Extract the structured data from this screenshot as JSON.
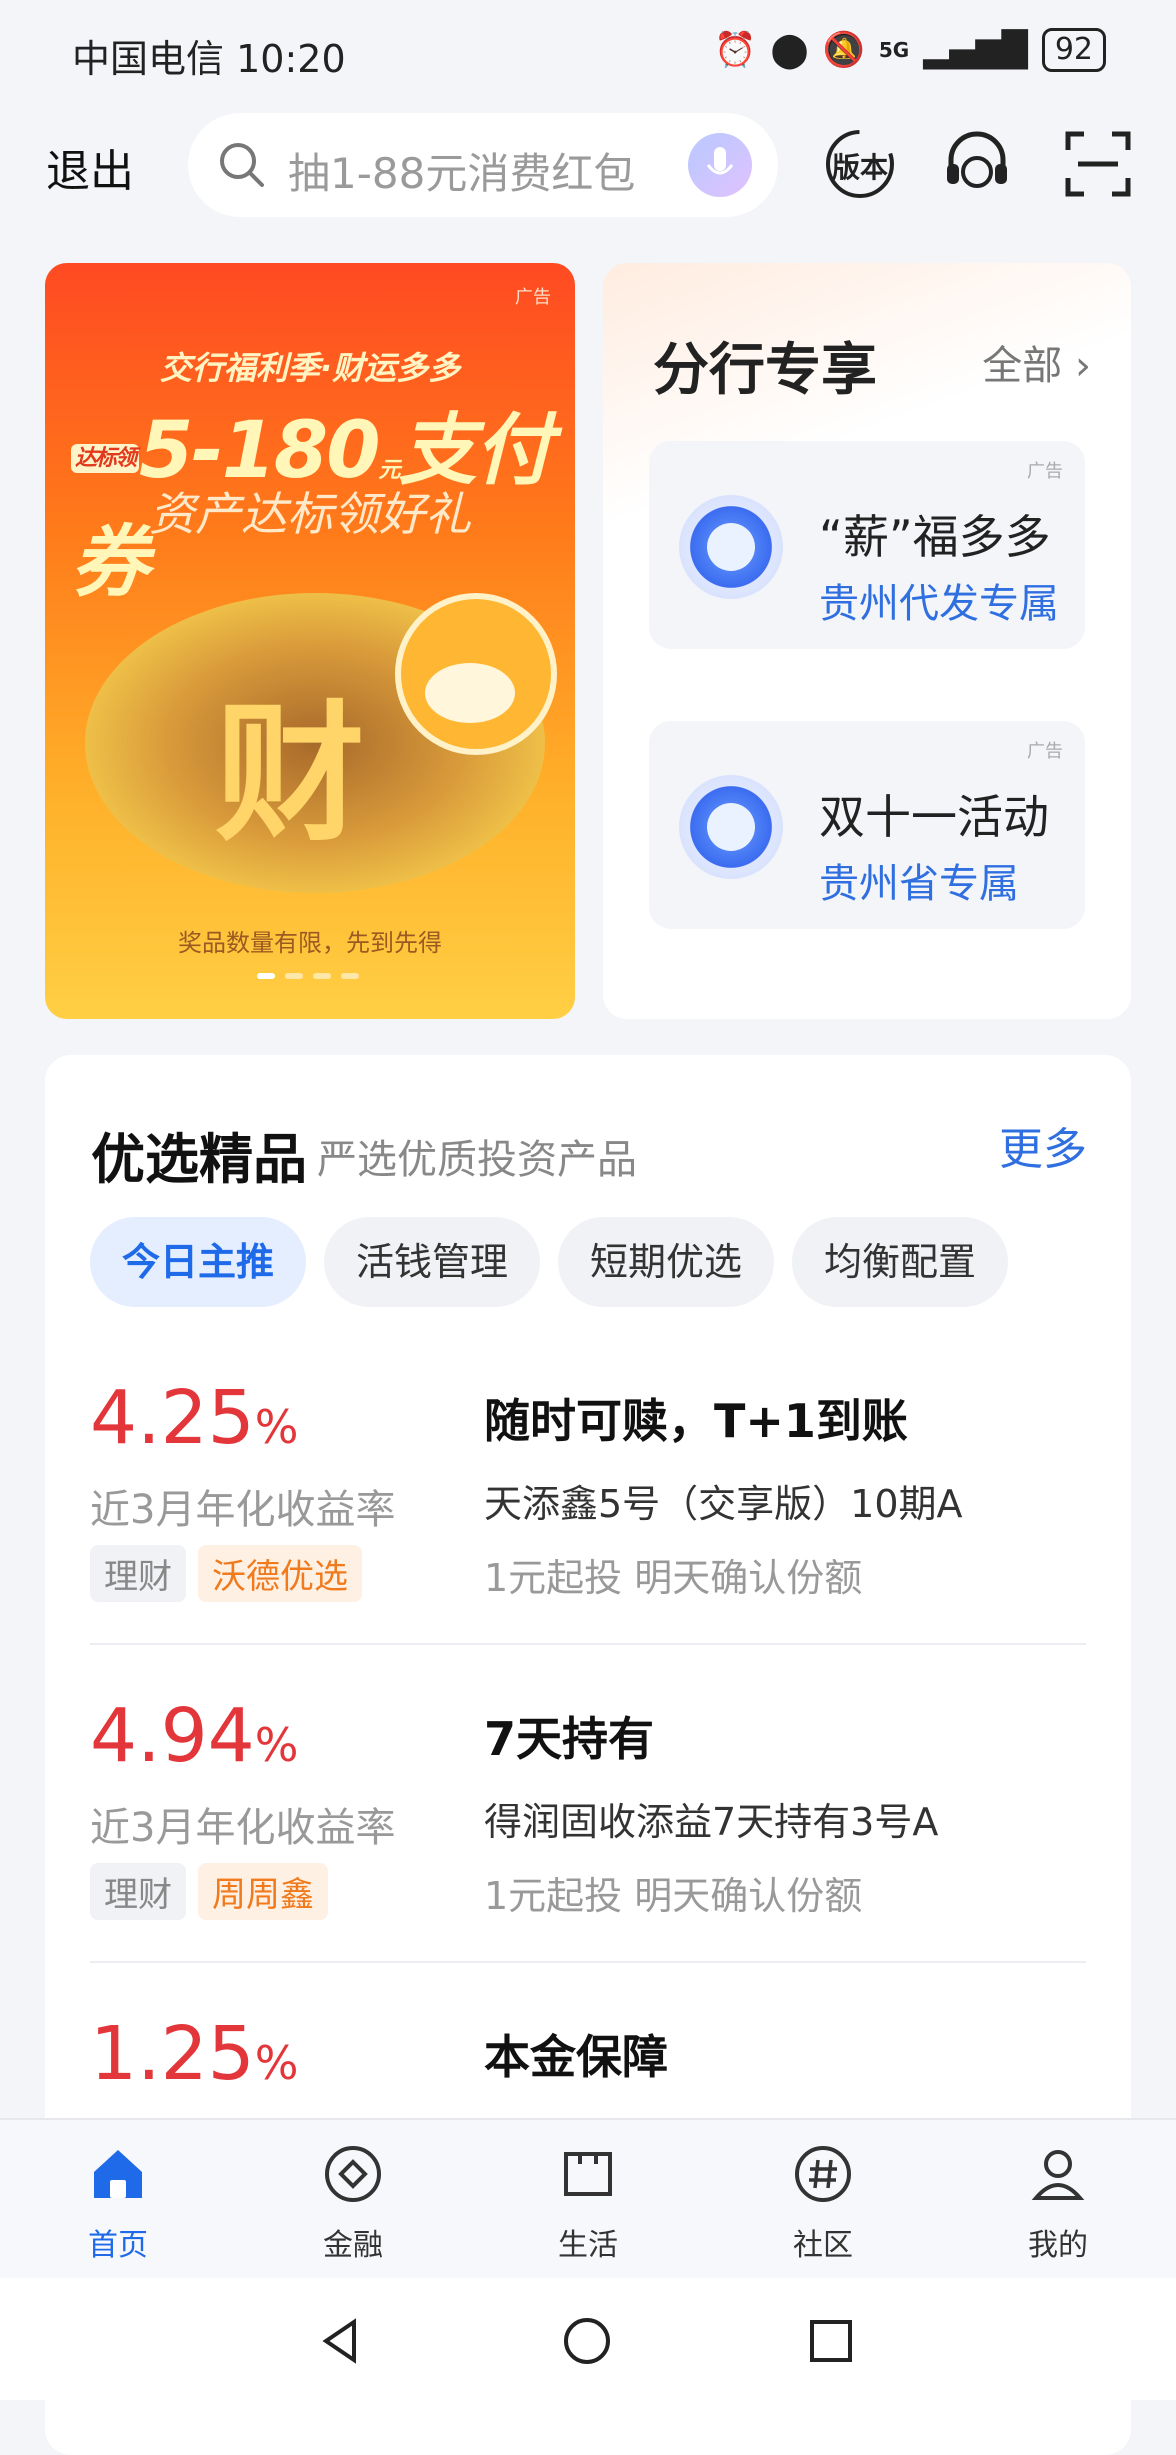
{
  "status_bar": {
    "carrier": "中国电信",
    "time": "10:20",
    "network": "5G",
    "battery": "92"
  },
  "top_bar": {
    "exit_label": "退出",
    "search_placeholder": "抽1-88元消费红包",
    "version_label": "版本"
  },
  "ad_banner": {
    "tag": "广告",
    "headline": "交行福利季·财运多多",
    "badge": "达标领",
    "amount": "5-180",
    "unit": "元",
    "coupon": "支付券",
    "subline": "资产达标领好礼",
    "center_char": "财",
    "note": "奖品数量有限，先到先得",
    "page_count": 4,
    "page_current": 1
  },
  "branch": {
    "title": "分行专享",
    "all_label": "全部",
    "items": [
      {
        "tag": "广告",
        "title": "“薪”福多多",
        "subtitle": "贵州代发专属"
      },
      {
        "tag": "广告",
        "title": "双十一活动",
        "subtitle": "贵州省专属"
      }
    ]
  },
  "products": {
    "title": "优选精品",
    "subtitle": "严选优质投资产品",
    "more_label": "更多",
    "tabs": [
      {
        "label": "今日主推",
        "active": true
      },
      {
        "label": "活钱管理",
        "active": false
      },
      {
        "label": "短期优选",
        "active": false
      },
      {
        "label": "均衡配置",
        "active": false
      }
    ],
    "items": [
      {
        "rate": "4.25",
        "rate_unit": "%",
        "rate_label": "近3月年化收益率",
        "badges": [
          "理财",
          "沃德优选"
        ],
        "title": "随时可赎，T+1到账",
        "name": "天添鑫5号（交享版）10期A",
        "desc": "1元起投 明天确认份额"
      },
      {
        "rate": "4.94",
        "rate_unit": "%",
        "rate_label": "近3月年化收益率",
        "badges": [
          "理财",
          "周周鑫"
        ],
        "title": "7天持有",
        "name": "得润固收添益7天持有3号A",
        "desc": "1元起投 明天确认份额"
      },
      {
        "rate": "1.25",
        "rate_unit": "%",
        "rate_label": "",
        "badges": [],
        "title": "本金保障",
        "name": "",
        "desc": ""
      }
    ]
  },
  "bottom_nav": [
    {
      "label": "首页",
      "active": true
    },
    {
      "label": "金融",
      "active": false
    },
    {
      "label": "生活",
      "active": false
    },
    {
      "label": "社区",
      "active": false
    },
    {
      "label": "我的",
      "active": false
    }
  ],
  "colors": {
    "accent": "#1f6ae8",
    "rate_red": "#e3363a",
    "tag_orange": "#f07a1c"
  }
}
